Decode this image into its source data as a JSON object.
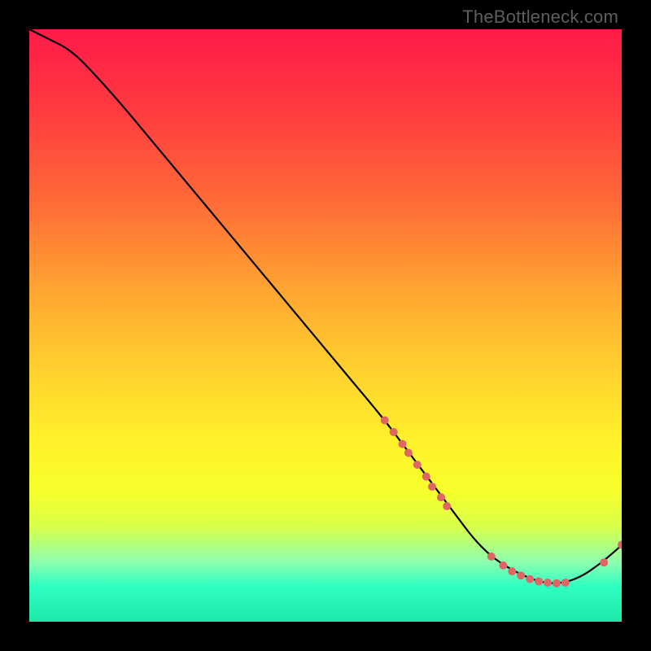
{
  "watermark": "TheBottleneck.com",
  "chart_data": {
    "type": "line",
    "title": "",
    "xlabel": "",
    "ylabel": "",
    "xlim": [
      0,
      100
    ],
    "ylim": [
      0,
      100
    ],
    "grid": false,
    "legend": false,
    "series": [
      {
        "name": "curve",
        "x": [
          0,
          2,
          4,
          6,
          8,
          10,
          15,
          20,
          25,
          30,
          35,
          40,
          45,
          50,
          55,
          60,
          63,
          66,
          69,
          72,
          75,
          78,
          81,
          84,
          87,
          90,
          93,
          96,
          99,
          100
        ],
        "y": [
          100,
          99,
          98,
          97,
          95.5,
          93.5,
          88,
          82,
          76,
          70,
          64,
          58,
          52,
          46,
          40,
          34,
          30,
          26,
          22,
          18,
          14,
          11,
          9,
          7.5,
          6.5,
          6.5,
          7.5,
          9.5,
          12,
          13
        ]
      }
    ],
    "markers": [
      {
        "x": 60,
        "y": 34
      },
      {
        "x": 61.5,
        "y": 32
      },
      {
        "x": 63,
        "y": 30
      },
      {
        "x": 64,
        "y": 28.5
      },
      {
        "x": 65.5,
        "y": 26.5
      },
      {
        "x": 67,
        "y": 24.5
      },
      {
        "x": 68,
        "y": 22.8
      },
      {
        "x": 69.5,
        "y": 21
      },
      {
        "x": 70.5,
        "y": 19.5
      },
      {
        "x": 78,
        "y": 11
      },
      {
        "x": 80,
        "y": 9.5
      },
      {
        "x": 81.5,
        "y": 8.5
      },
      {
        "x": 83,
        "y": 7.8
      },
      {
        "x": 84.5,
        "y": 7.2
      },
      {
        "x": 86,
        "y": 6.8
      },
      {
        "x": 87.5,
        "y": 6.6
      },
      {
        "x": 89,
        "y": 6.5
      },
      {
        "x": 90.5,
        "y": 6.6
      },
      {
        "x": 97,
        "y": 10
      },
      {
        "x": 100,
        "y": 13
      }
    ],
    "marker_color": "#e06666",
    "line_color": "#000000"
  }
}
